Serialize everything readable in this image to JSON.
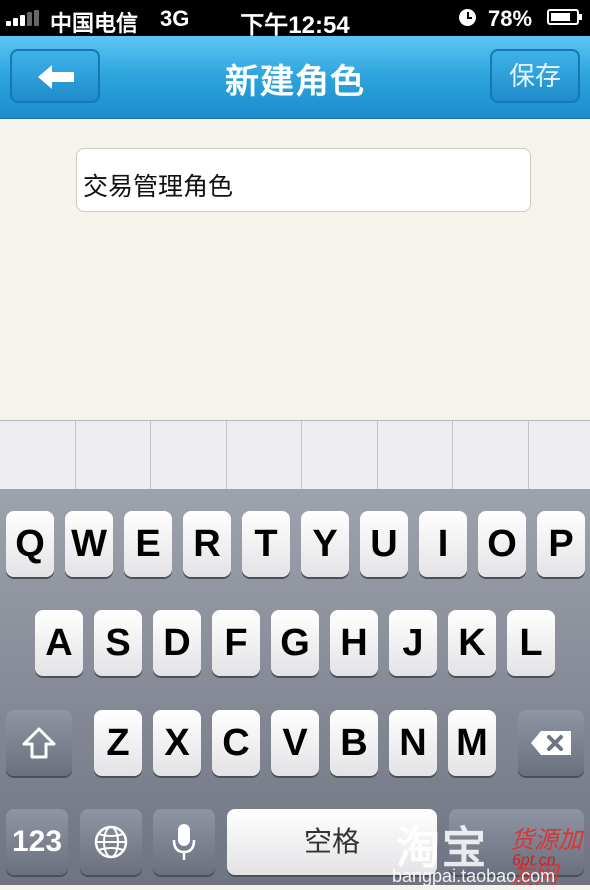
{
  "status_bar": {
    "carrier": "中国电信",
    "network": "3G",
    "time": "下午12:54",
    "battery_percent": "78%",
    "battery_level": 0.78,
    "signal_bars": 3
  },
  "nav": {
    "title": "新建角色",
    "save_label": "保存",
    "back_icon": "back-arrow-icon"
  },
  "form": {
    "role_name_value": "交易管理角色"
  },
  "keyboard": {
    "row1": [
      "Q",
      "W",
      "E",
      "R",
      "T",
      "Y",
      "U",
      "I",
      "O",
      "P"
    ],
    "row2": [
      "A",
      "S",
      "D",
      "F",
      "G",
      "H",
      "J",
      "K",
      "L"
    ],
    "row3": [
      "Z",
      "X",
      "C",
      "V",
      "B",
      "N",
      "M"
    ],
    "numbers_label": "123",
    "space_label": "空格",
    "icons": [
      "shift-icon",
      "backspace-icon",
      "globe-icon",
      "microphone-icon"
    ]
  },
  "watermark": {
    "brand": "淘宝",
    "script_text": "货源加发网",
    "url": "bangpai.taobao.com",
    "site": "6pt.cn"
  }
}
